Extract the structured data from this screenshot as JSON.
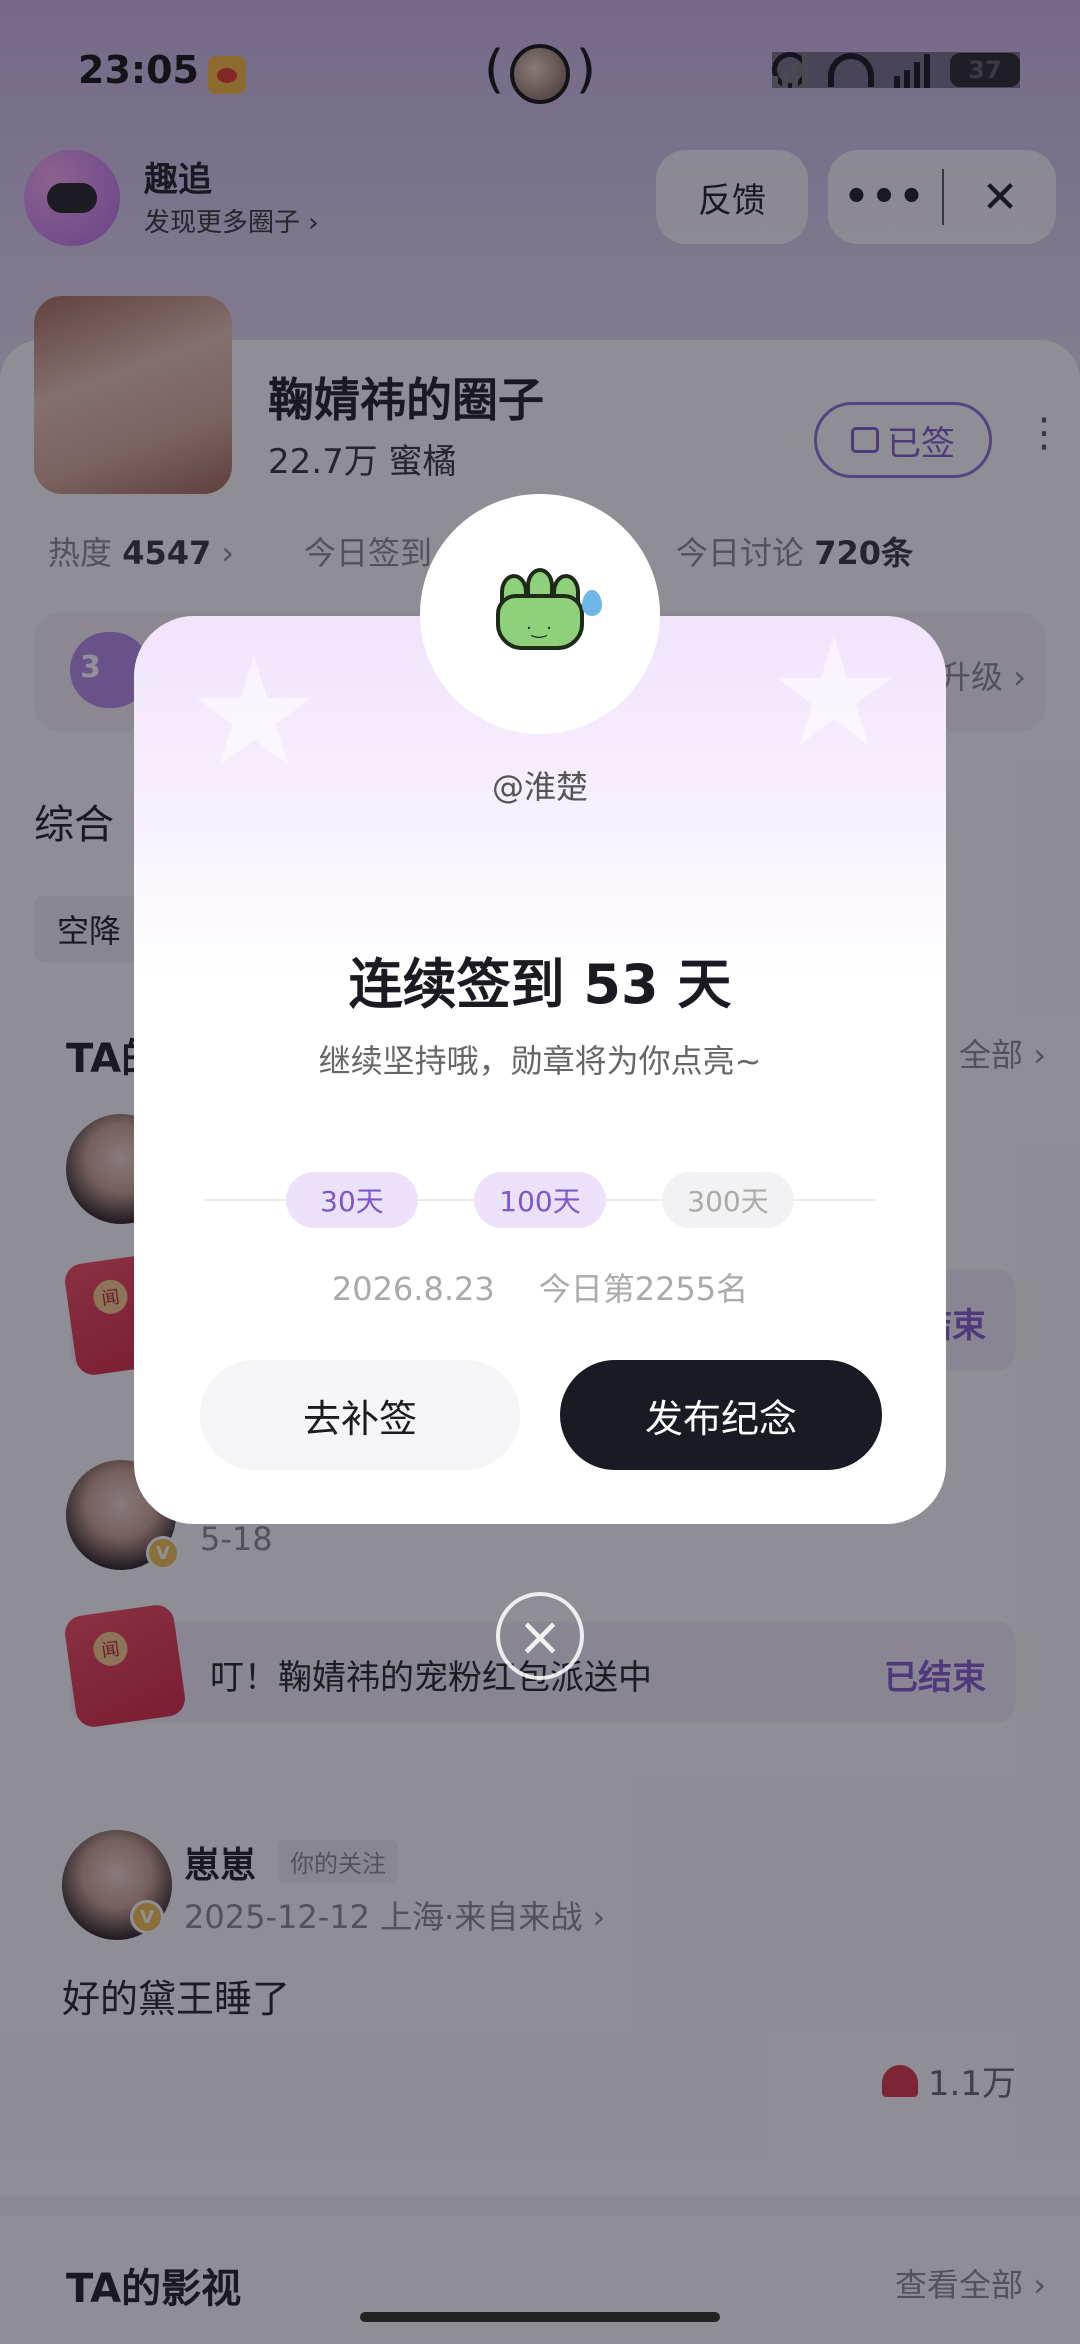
{
  "status_bar": {
    "time": "23:05",
    "battery": "37"
  },
  "app": {
    "name": "趣追",
    "subtitle": "发现更多圈子 ›",
    "feedback": "反馈",
    "more": "•••",
    "close": "✕"
  },
  "circle": {
    "name": "鞠婧祎的圈子",
    "fans": "22.7万 蜜橘",
    "signed": "已签",
    "stats": {
      "heat_label": "热度",
      "heat_value": "4547",
      "today_sign_label": "今日签到",
      "today_discuss_label": "今日讨论",
      "today_discuss_value": "720条"
    },
    "level_number": "3",
    "level_upgrade": "升级 ›"
  },
  "tabs": {
    "overview": "综合"
  },
  "filter_chip": "空降",
  "section_ta": {
    "title": "TA的动态",
    "all": "全部 ›"
  },
  "posts": [
    {
      "date_short": "5-18",
      "redpack_text": "叮！鞠婧祎的宠粉红包派送中",
      "redpack_status": "已结束"
    },
    {
      "author": "崽崽",
      "follow_tag": "你的关注",
      "meta": "2025-12-12 上海·来自来战 ›",
      "text": "好的黛王睡了",
      "likes": "1.1万"
    }
  ],
  "footer": {
    "title": "TA的影视",
    "all": "查看全部 ›"
  },
  "modal": {
    "username": "@淮楚",
    "title": "连续签到 53 天",
    "subtitle": "继续坚持哦，勋章将为你点亮~",
    "milestones": [
      "30天",
      "100天",
      "300天"
    ],
    "date": "2026.8.23",
    "rank": "今日第2255名",
    "makeup_button": "去补签",
    "publish_button": "发布纪念"
  },
  "colors": {
    "accent": "#7d58cc",
    "publish_button": "#181a24",
    "like": "#d9334a"
  }
}
